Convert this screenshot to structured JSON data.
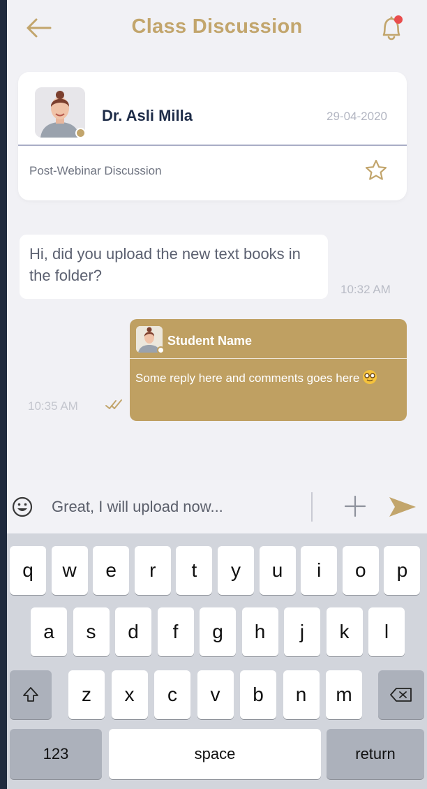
{
  "header": {
    "title": "Class Discussion",
    "back_icon": "arrow-left-icon",
    "bell_icon": "bell-icon",
    "notification_color": "#e94d4d"
  },
  "post": {
    "author": "Dr. Asli Milla",
    "date": "29-04-2020",
    "subject": "Post-Webinar Discussion",
    "favorite_icon": "star-outline-icon"
  },
  "messages": {
    "incoming": {
      "text": "Hi, did you upload the new text books in the folder?",
      "time": "10:32 AM"
    },
    "reply": {
      "sender": "Student Name",
      "text": "Some reply here and comments goes here",
      "emoji": "nerd-face-emoji",
      "time": "10:35 AM",
      "status_icon": "double-check-icon"
    }
  },
  "composer": {
    "value": "Great, I will upload now...",
    "emoji_icon": "smiley-icon",
    "attach_icon": "plus-icon",
    "send_icon": "send-icon"
  },
  "keyboard": {
    "row1": [
      "q",
      "w",
      "e",
      "r",
      "t",
      "y",
      "u",
      "i",
      "o",
      "p"
    ],
    "row2": [
      "a",
      "s",
      "d",
      "f",
      "g",
      "h",
      "j",
      "k",
      "l"
    ],
    "row3": [
      "z",
      "x",
      "c",
      "v",
      "b",
      "n",
      "m"
    ],
    "numbers_label": "123",
    "space_label": "space",
    "return_label": "return"
  },
  "colors": {
    "accent": "#c2a56c",
    "reply_bubble": "#bfa062",
    "author_text": "#1e2c48",
    "frame": "#1f2a3d",
    "background": "#f1f1f5"
  }
}
